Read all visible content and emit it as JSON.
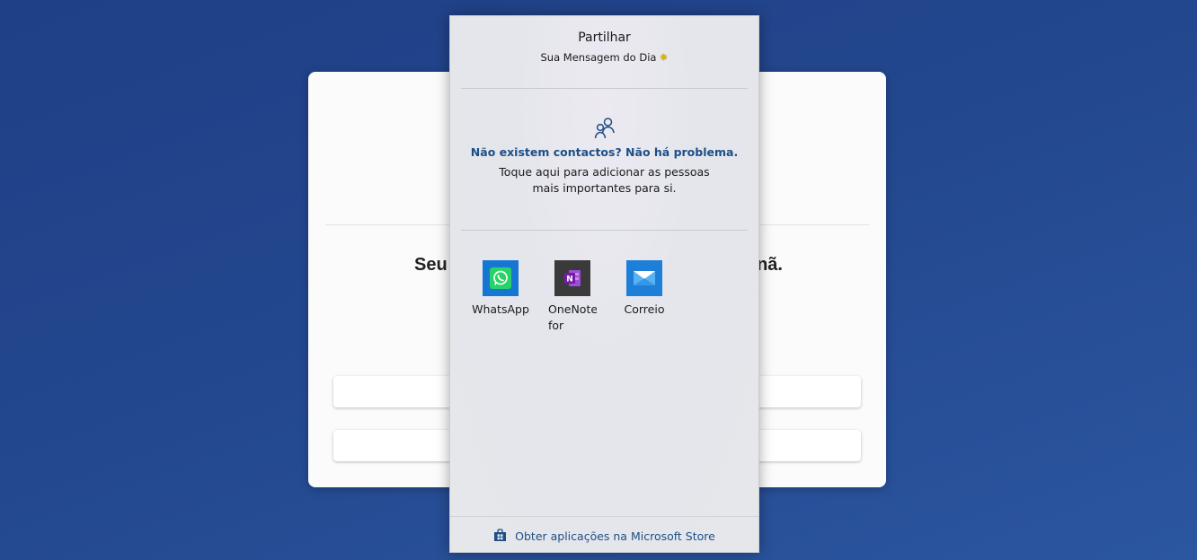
{
  "background_app": {
    "message_left": "Seu",
    "message_right": "nã."
  },
  "share": {
    "title": "Partilhar",
    "subtitle": "Sua Mensagem do Dia",
    "subtitle_emoji": "✸",
    "contacts": {
      "icon": "people-icon",
      "title": "Não existem contactos? Não há problema.",
      "description": "Toque aqui para adicionar as pessoas mais importantes para si."
    },
    "apps": [
      {
        "label": "WhatsApp",
        "icon": "whatsapp-icon",
        "color": "#1677d2"
      },
      {
        "label": "OneNote for Windows",
        "icon": "onenote-icon",
        "color": "#3a3a3a"
      },
      {
        "label": "Correio",
        "icon": "mail-icon",
        "color": "#1e7fd8"
      }
    ],
    "store_link": {
      "icon": "store-bag-icon",
      "label": "Obter aplicações na Microsoft Store"
    }
  },
  "colors": {
    "desktop_background": "#23478e",
    "link_blue": "#1d4f86"
  }
}
